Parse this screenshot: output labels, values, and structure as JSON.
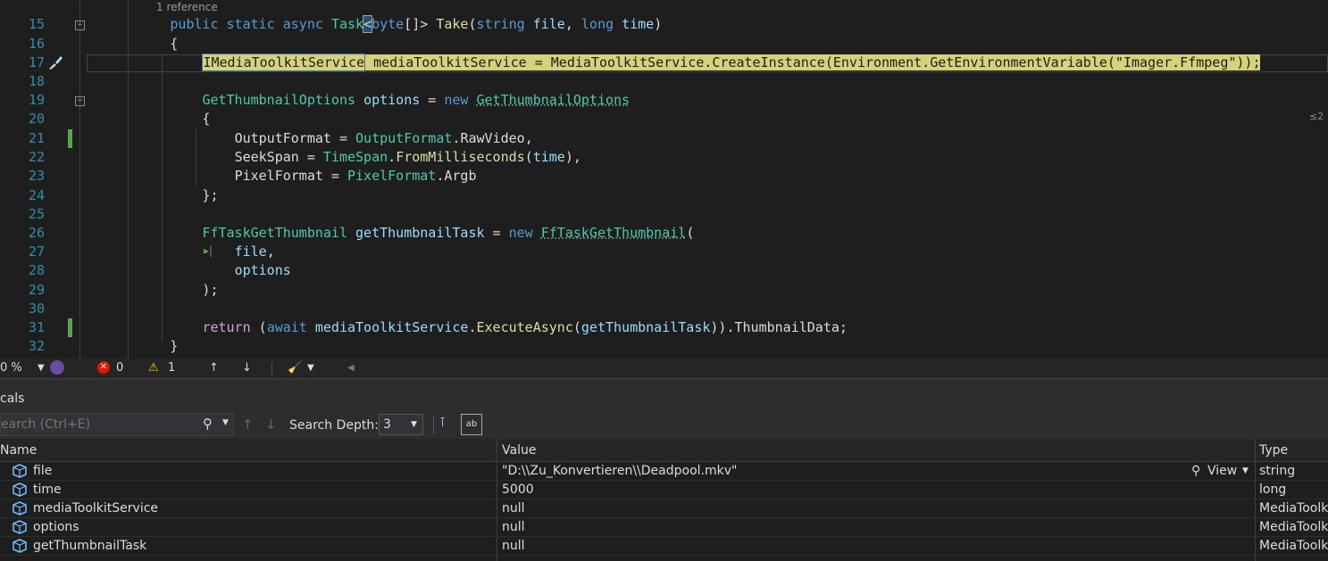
{
  "editor": {
    "reference_hint": "1 reference",
    "line_numbers": [
      "15",
      "16",
      "17",
      "18",
      "19",
      "20",
      "21",
      "22",
      "23",
      "24",
      "25",
      "26",
      "27",
      "28",
      "29",
      "30",
      "31",
      "32"
    ],
    "end_hint": "≤2"
  },
  "status": {
    "zoom": "0 %",
    "errors": "0",
    "warnings": "1"
  },
  "locals": {
    "title": "cals",
    "search_placeholder": "earch (Ctrl+E)",
    "search_depth_label": "Search Depth:",
    "search_depth_value": "3",
    "columns": {
      "name": "Name",
      "value": "Value",
      "type": "Type"
    },
    "view_label": "View",
    "rows": [
      {
        "name": "file",
        "value": "\"D:\\\\Zu_Konvertieren\\\\Deadpool.mkv\"",
        "type": "string"
      },
      {
        "name": "time",
        "value": "5000",
        "type": "long"
      },
      {
        "name": "mediaToolkitService",
        "value": "null",
        "type": "MediaToolk"
      },
      {
        "name": "options",
        "value": "null",
        "type": "MediaToolk"
      },
      {
        "name": "getThumbnailTask",
        "value": "null",
        "type": "MediaToolk"
      }
    ]
  },
  "colors": {
    "accent": "#569cd6",
    "type": "#4ec9b0",
    "change_bar": "#57a64a",
    "highlight": "#d5d27b"
  }
}
